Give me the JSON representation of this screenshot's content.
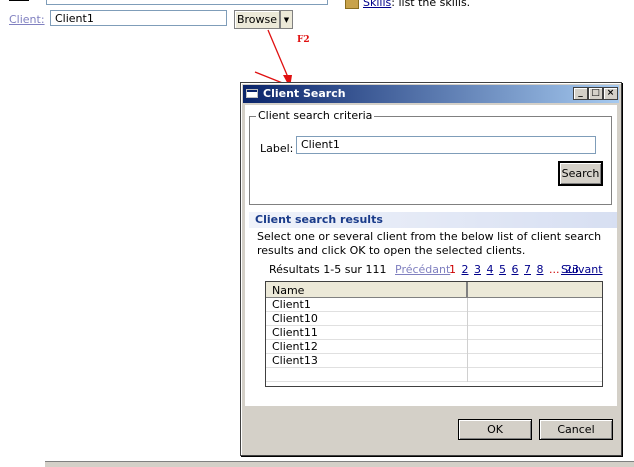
{
  "page": {
    "client_label": "Client:",
    "client_value": "Client1",
    "browse_label": "Browse",
    "skills_link": "Skills",
    "skills_desc": ": list the skills.",
    "f2_annotation": "F2",
    "arrow_color": "#e01010"
  },
  "dialog": {
    "title": "Client Search",
    "criteria": {
      "legend": "Client search criteria",
      "label_text": "Label:",
      "label_value": "Client1",
      "search_button": "Search"
    },
    "results": {
      "header": "Client search results",
      "description": "Select one or several client from the below list of client search results and click OK to open the selected clients.",
      "count_text": "Résultats 1-5 sur 111",
      "prev_label": "Précédant",
      "current_page": "1",
      "pages": [
        "2",
        "3",
        "4",
        "5",
        "6",
        "7",
        "8"
      ],
      "dots": "...",
      "last_page": "23",
      "next_label": "Suivant",
      "columns": [
        "Name",
        ""
      ],
      "rows": [
        "Client1",
        "Client10",
        "Client11",
        "Client12",
        "Client13",
        ""
      ]
    },
    "ok_button": "OK",
    "cancel_button": "Cancel"
  }
}
